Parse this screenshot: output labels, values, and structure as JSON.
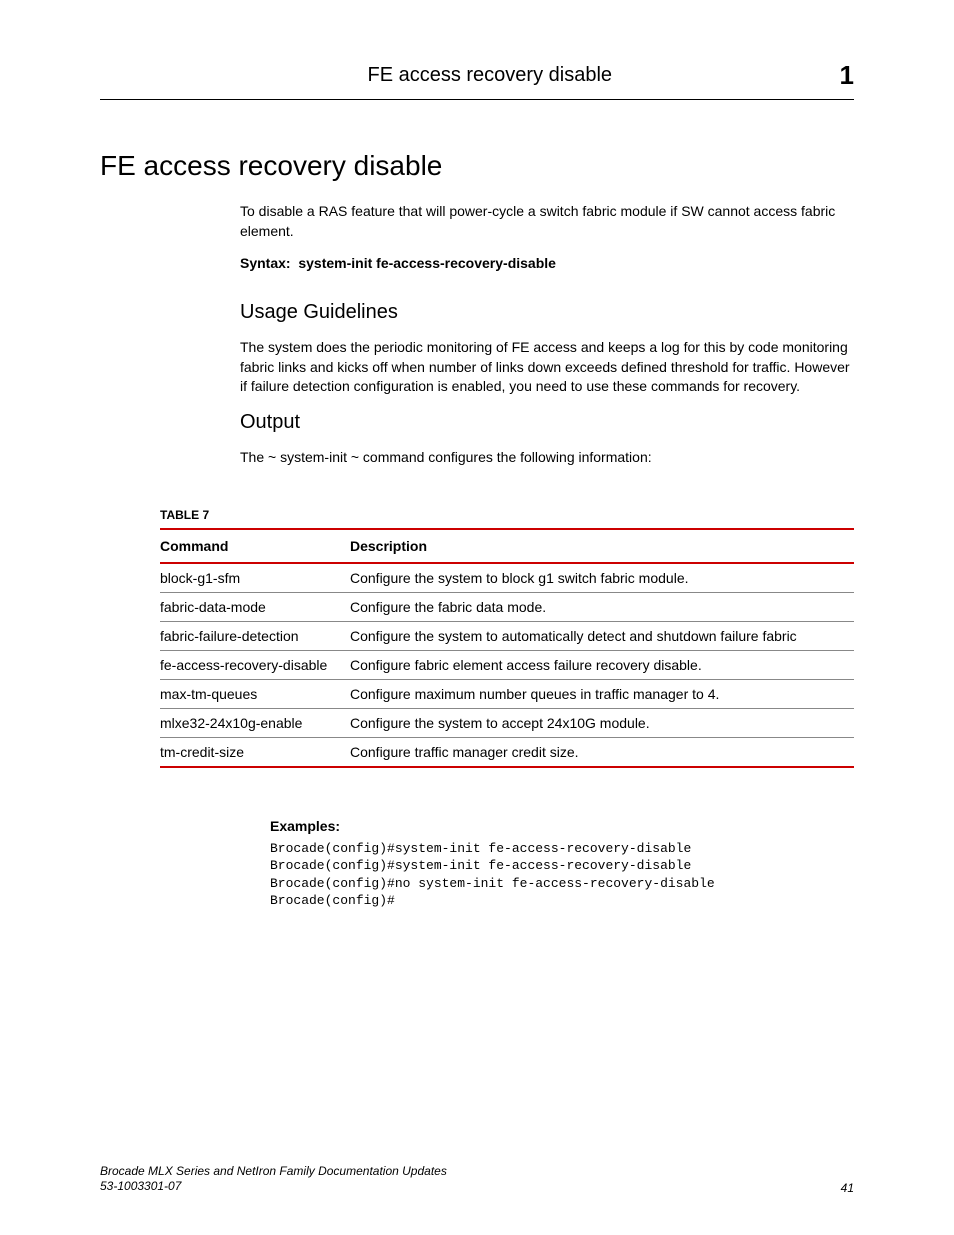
{
  "header": {
    "title": "FE access recovery disable",
    "chapter_num": "1"
  },
  "main": {
    "h1": "FE access recovery disable",
    "intro_para": "To disable a RAS feature that will power-cycle a switch fabric module if SW cannot access fabric element.",
    "syntax_label": "Syntax:",
    "syntax_cmd": "system-init fe-access-recovery-disable",
    "usage_heading": "Usage Guidelines",
    "usage_para": "The system does the periodic monitoring of FE access and keeps a log for this by code monitoring fabric links and kicks off when number of links down exceeds defined threshold for traffic. However if failure detection configuration is enabled, you need to use these commands for recovery.",
    "output_heading": "Output",
    "output_para": "The ~ system-init ~ command configures the following information:"
  },
  "table": {
    "label": "TABLE 7",
    "col1": "Command",
    "col2": "Description",
    "rows": [
      {
        "cmd": "block-g1-sfm",
        "desc": "Configure the system to block g1 switch fabric module."
      },
      {
        "cmd": "fabric-data-mode",
        "desc": "Configure the fabric data mode."
      },
      {
        "cmd": "fabric-failure-detection",
        "desc": "Configure the system to automatically detect and shutdown failure fabric"
      },
      {
        "cmd": "fe-access-recovery-disable",
        "desc": "Configure fabric element access failure recovery disable."
      },
      {
        "cmd": "max-tm-queues",
        "desc": "Configure maximum number queues in traffic manager to 4."
      },
      {
        "cmd": "mlxe32-24x10g-enable",
        "desc": "Configure the system to accept 24x10G module."
      },
      {
        "cmd": "tm-credit-size",
        "desc": "Configure traffic manager credit size."
      }
    ]
  },
  "examples": {
    "label": "Examples:",
    "lines": [
      "Brocade(config)#system-init fe-access-recovery-disable",
      "Brocade(config)#system-init fe-access-recovery-disable",
      "Brocade(config)#no system-init fe-access-recovery-disable",
      "Brocade(config)#"
    ]
  },
  "footer": {
    "doc_title": "Brocade MLX Series and NetIron Family Documentation Updates",
    "doc_number": "53-1003301-07",
    "page_num": "41"
  }
}
